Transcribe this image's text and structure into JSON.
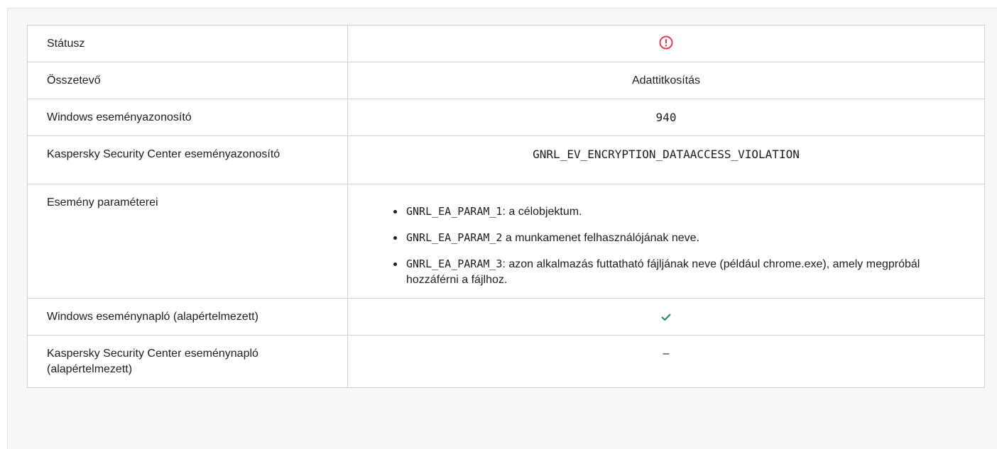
{
  "rows": {
    "status": {
      "label": "Státusz",
      "icon": "warning-circle-icon",
      "icon_color": "#e0404a"
    },
    "component": {
      "label": "Összetevő",
      "value": "Adattitkosítás"
    },
    "windows_event_id": {
      "label": "Windows eseményazonosító",
      "value": "940"
    },
    "ksc_event_id": {
      "label": "Kaspersky Security Center eseményazonosító",
      "value": "GNRL_EV_ENCRYPTION_DATAACCESS_VIOLATION"
    },
    "event_params": {
      "label": "Esemény paraméterei",
      "items": [
        {
          "code": "GNRL_EA_PARAM_1",
          "text": ": a célobjektum."
        },
        {
          "code": "GNRL_EA_PARAM_2",
          "text": " a munkamenet felhasználójának neve."
        },
        {
          "code": "GNRL_EA_PARAM_3",
          "text": ": azon alkalmazás futtatható fájljának neve (például chrome.exe), amely megpróbál hozzáférni a fájlhoz."
        }
      ]
    },
    "windows_log": {
      "label": "Windows eseménynapló (alapértelmezett)",
      "icon": "check-icon",
      "icon_color": "#1f8a5b"
    },
    "ksc_log": {
      "label": "Kaspersky Security Center eseménynapló (alapértelmezett)",
      "value": "–"
    }
  }
}
